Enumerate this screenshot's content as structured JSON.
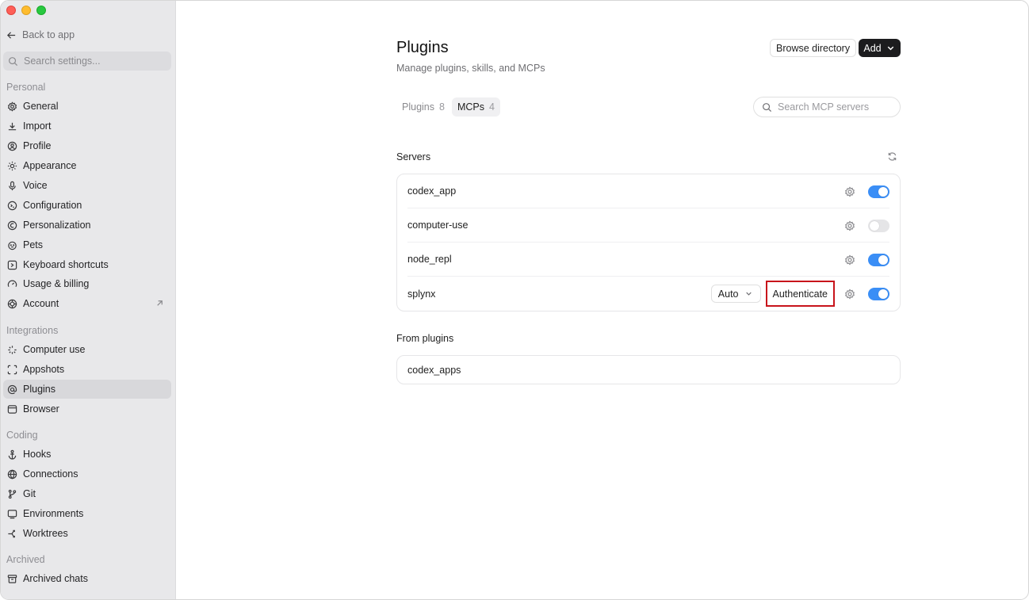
{
  "sidebar": {
    "back_label": "Back to app",
    "search_placeholder": "Search settings...",
    "sections": {
      "personal": "Personal",
      "integrations": "Integrations",
      "coding": "Coding",
      "archived": "Archived"
    },
    "personal_items": [
      {
        "label": "General",
        "icon": "gear-icon"
      },
      {
        "label": "Import",
        "icon": "download-icon"
      },
      {
        "label": "Profile",
        "icon": "profile-icon"
      },
      {
        "label": "Appearance",
        "icon": "sun-icon"
      },
      {
        "label": "Voice",
        "icon": "microphone-icon"
      },
      {
        "label": "Configuration",
        "icon": "config-icon"
      },
      {
        "label": "Personalization",
        "icon": "personalization-icon"
      },
      {
        "label": "Pets",
        "icon": "pet-icon"
      },
      {
        "label": "Keyboard shortcuts",
        "icon": "keyboard-icon"
      },
      {
        "label": "Usage & billing",
        "icon": "gauge-icon"
      },
      {
        "label": "Account",
        "icon": "account-icon"
      }
    ],
    "integration_items": [
      {
        "label": "Computer use",
        "icon": "sparkle-icon"
      },
      {
        "label": "Appshots",
        "icon": "screenshot-icon"
      },
      {
        "label": "Plugins",
        "icon": "at-icon",
        "active": true
      },
      {
        "label": "Browser",
        "icon": "browser-icon"
      }
    ],
    "coding_items": [
      {
        "label": "Hooks",
        "icon": "anchor-icon"
      },
      {
        "label": "Connections",
        "icon": "globe-icon"
      },
      {
        "label": "Git",
        "icon": "branch-icon"
      },
      {
        "label": "Environments",
        "icon": "monitor-icon"
      },
      {
        "label": "Worktrees",
        "icon": "worktree-icon"
      }
    ],
    "archived_items": [
      {
        "label": "Archived chats",
        "icon": "archive-icon"
      }
    ]
  },
  "main": {
    "title": "Plugins",
    "subtitle": "Manage plugins, skills, and MCPs",
    "browse_label": "Browse directory",
    "add_label": "Add",
    "tabs": [
      {
        "label": "Plugins",
        "count": "8"
      },
      {
        "label": "MCPs",
        "count": "4",
        "active": true
      }
    ],
    "search_placeholder": "Search MCP servers",
    "servers_label": "Servers",
    "servers": [
      {
        "name": "codex_app",
        "enabled": true
      },
      {
        "name": "computer-use",
        "enabled": false
      },
      {
        "name": "node_repl",
        "enabled": true
      },
      {
        "name": "splynx",
        "enabled": true,
        "mode": "Auto",
        "auth_label": "Authenticate"
      }
    ],
    "from_plugins_label": "From plugins",
    "plugin_servers": [
      {
        "name": "codex_apps"
      }
    ]
  },
  "colors": {
    "toggle_on": "#3a8ef6",
    "highlight_border": "#c8141b",
    "sidebar_bg": "#e8e8ea"
  }
}
